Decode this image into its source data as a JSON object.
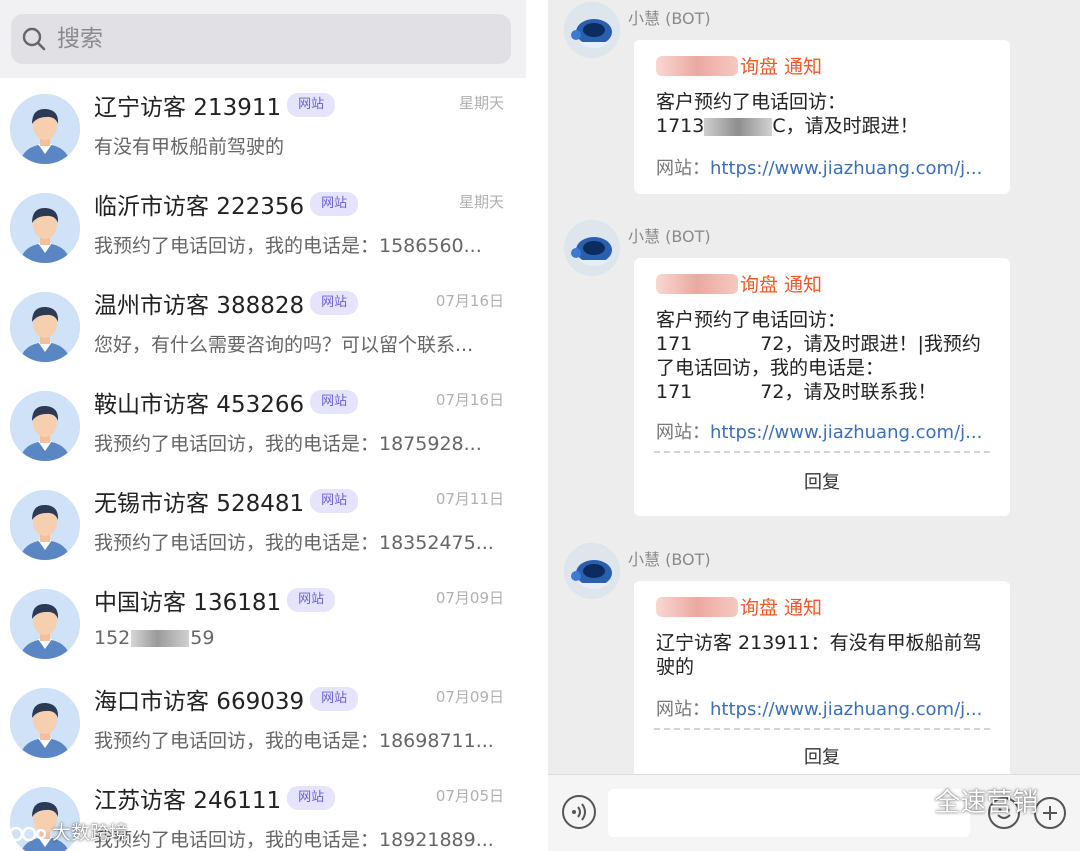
{
  "search": {
    "placeholder": "搜索"
  },
  "conversations": [
    {
      "name": "辽宁访客 213911",
      "badge": "网站",
      "date": "星期天",
      "preview": "有没有甲板船前驾驶的"
    },
    {
      "name": "临沂市访客 222356",
      "badge": "网站",
      "date": "星期天",
      "preview": "我预约了电话回访，我的电话是：1586560..."
    },
    {
      "name": "温州市访客 388828",
      "badge": "网站",
      "date": "07月16日",
      "preview": "您好，有什么需要咨询的吗？可以留个联系..."
    },
    {
      "name": "鞍山市访客 453266",
      "badge": "网站",
      "date": "07月16日",
      "preview": "我预约了电话回访，我的电话是：1875928..."
    },
    {
      "name": "无锡市访客 528481",
      "badge": "网站",
      "date": "07月11日",
      "preview": "我预约了电话回访，我的电话是：18352475..."
    },
    {
      "name": "中国访客 136181",
      "badge": "网站",
      "date": "07月09日",
      "preview_prefix": "152",
      "preview_suffix": "59"
    },
    {
      "name": "海口市访客 669039",
      "badge": "网站",
      "date": "07月09日",
      "preview": "我预约了电话回访，我的电话是：18698711..."
    },
    {
      "name": "江苏访客 246111",
      "badge": "网站",
      "date": "07月05日",
      "preview": "我预约了电话回访，我的电话是：18921889..."
    }
  ],
  "messages": [
    {
      "sender": "小慧 (BOT)",
      "title": "询盘 通知",
      "body_line1": "客户预约了电话回访：",
      "body_line2_prefix": "1713",
      "body_line2_suffix": "C，请及时跟进！",
      "site_label": "网站：",
      "site_url": "https://www.jiazhuang.com/j..."
    },
    {
      "sender": "小慧 (BOT)",
      "title": "询盘 通知",
      "body_line1": "客户预约了电话回访：",
      "body_line2_prefix": "171",
      "body_line2_suffix": "72，请及时跟进！|我预约",
      "body_line3": "了电话回访，我的电话是：",
      "body_line4_prefix": "171",
      "body_line4_suffix": "72，请及时联系我！",
      "site_label": "网站：",
      "site_url": "https://www.jiazhuang.com/j...",
      "reply": "回复"
    },
    {
      "sender": "小慧 (BOT)",
      "title": "询盘 通知",
      "body_line1": "辽宁访客 213911：有没有甲板船前驾",
      "body_line2": "驶的",
      "site_label": "网站：",
      "site_url": "https://www.jiazhuang.com/j...",
      "reply": "回复"
    }
  ],
  "watermarks": {
    "left": "大数跨境",
    "right": "全速营销"
  },
  "colors": {
    "badge_bg": "#e6e4fc",
    "badge_text": "#6a5fd6",
    "notice_orange": "#f0582a",
    "link_blue": "#3c6fb4",
    "chat_bg": "#ededed"
  }
}
